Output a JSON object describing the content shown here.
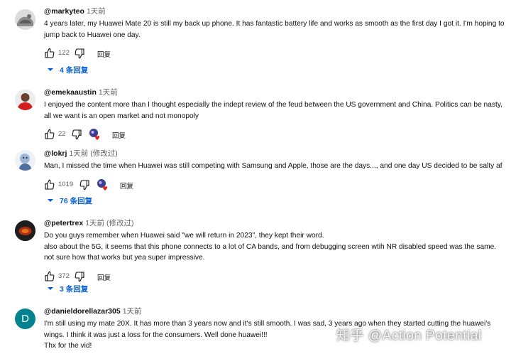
{
  "comments": [
    {
      "author": "@markyteo",
      "time": "1天前",
      "edited": "",
      "lines": [
        "4 years later, my Huawei Mate 20 is still my back up phone. It has fantastic battery life and works as smooth as the first day I got it. I'm hoping to",
        "jump back to Huawei one day."
      ],
      "likes": "122",
      "reply_label": "回复",
      "replies_label": "4 条回复"
    },
    {
      "author": "@emekaaustin",
      "time": "1天前",
      "edited": "",
      "lines": [
        "I enjoyed the content more than I thought especially the indept review of the feud between the US government and China. Politics can be nasty,",
        "all we want is an open market and not monopoly"
      ],
      "likes": "22",
      "reply_label": "回复",
      "replies_label": ""
    },
    {
      "author": "@lokrj",
      "time": "1天前",
      "edited": "(修改过)",
      "lines": [
        "Man, I missed the time when Huawei was still competing with Samsung and Apple, those are the days..., and one day US decided to be salty af"
      ],
      "likes": "1019",
      "reply_label": "回复",
      "replies_label": "76 条回复"
    },
    {
      "author": "@petertrex",
      "time": "1天前",
      "edited": "(修改过)",
      "lines": [
        "Do you guys remember when Huawei said \"we will return in 2023\", they kept their word.",
        "also about the 5G, it seems that this phone connects to a lot of CA bands, and from debugging screen wtih NR disabled speed was the same.",
        "not sure how that works but yea super impressive."
      ],
      "likes": "372",
      "reply_label": "回复",
      "replies_label": "3 条回复"
    },
    {
      "author": "@danieldorellazar305",
      "time": "1天前",
      "edited": "",
      "lines": [
        "I'm still using my mate 20X. It has more than 3 years now and it's still smooth. I was sad, 3 years ago when they started cutting the huawei's",
        "wings. I think it was just a loss for the consumers. Well done huawei!!!",
        "Thx for the vid!"
      ],
      "avatar_letter": "D",
      "likes": "",
      "reply_label": "",
      "replies_label": ""
    }
  ],
  "watermark": "知乎 @Action Potential",
  "colors": {
    "accent": "#065fd4",
    "secondary_text": "#606060",
    "avatar_d": "#00838f"
  }
}
